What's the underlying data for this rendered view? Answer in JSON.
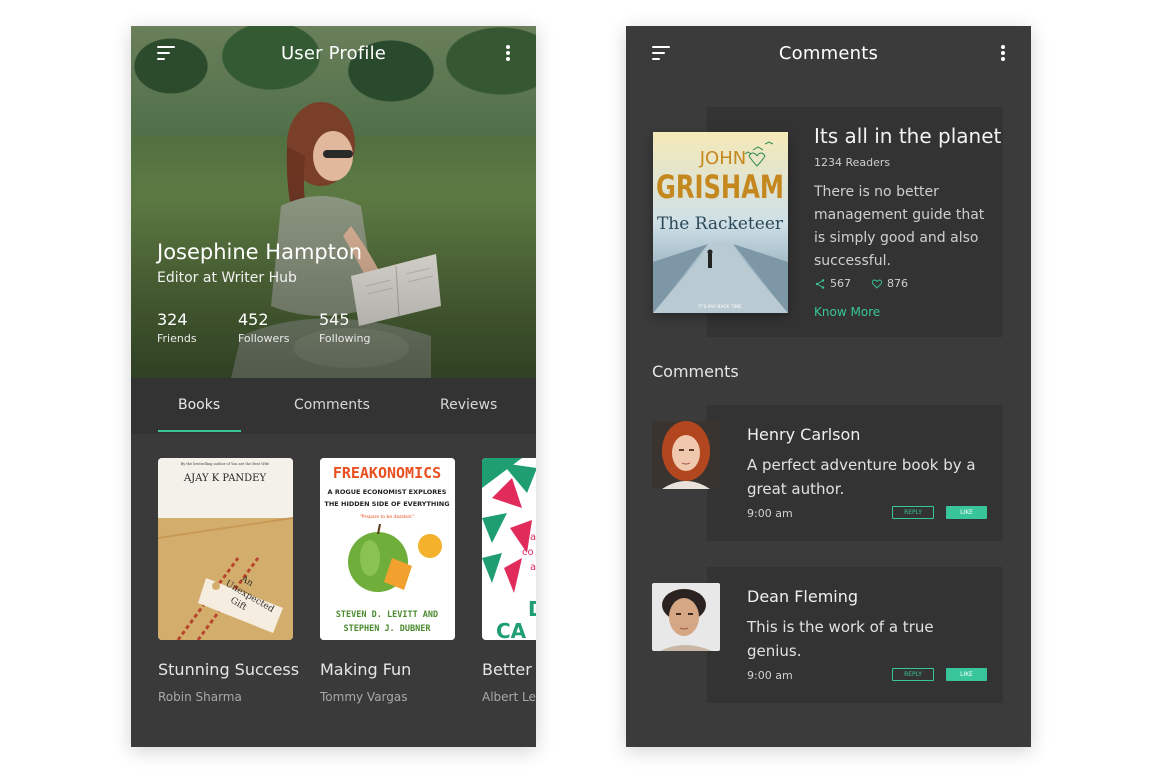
{
  "colors": {
    "accent": "#38c59a",
    "panel": "#3a3a3a",
    "card": "#333333"
  },
  "profile_screen": {
    "title": "User Profile",
    "menu_icon": "menu-icon",
    "more_icon": "more-vertical-icon",
    "name": "Josephine Hampton",
    "role": "Editor at Writer Hub",
    "stats": [
      {
        "value": "324",
        "label": "Friends"
      },
      {
        "value": "452",
        "label": "Followers"
      },
      {
        "value": "545",
        "label": "Following"
      }
    ],
    "tabs": [
      {
        "label": "Books",
        "active": true
      },
      {
        "label": "Comments",
        "active": false
      },
      {
        "label": "Reviews",
        "active": false
      }
    ],
    "books": [
      {
        "title": "Stunning Success",
        "author": "Robin Sharma",
        "cover": {
          "tagline": "By the bestselling author of You are the Best Wife",
          "cover_author": "AJAY K PANDEY",
          "cover_title_lines": [
            "An",
            "Unexpected",
            "Gift"
          ]
        }
      },
      {
        "title": "Making Fun",
        "author": "Tommy Vargas",
        "cover": {
          "cover_title": "FREAKONOMICS",
          "subtitle_lines": [
            "A ROGUE ECONOMIST EXPLORES",
            "THE HIDDEN SIDE OF EVERYTHING"
          ],
          "quote": "\"Prepare to be dazzled.\"",
          "authors_lines": [
            "STEVEN D. LEVITT AND",
            "STEPHEN J. DUBNER"
          ]
        }
      },
      {
        "title": "Better",
        "author": "Albert Lev",
        "cover": {
          "text_lines": [
            "a",
            "co",
            "a"
          ],
          "big_text_lines": [
            "D",
            "CA"
          ]
        }
      }
    ]
  },
  "comments_screen": {
    "title": "Comments",
    "menu_icon": "menu-icon",
    "more_icon": "more-vertical-icon",
    "featured": {
      "title": "Its all in the planet",
      "readers": "1234 Readers",
      "description": "There is no better management guide that is simply good and also successful.",
      "shares": "567",
      "likes": "876",
      "link": "Know More",
      "cover": {
        "author_first": "JOHN",
        "author_last": "GRISHAM",
        "cover_title": "The Racketeer",
        "tagline": "IT'S PAY BACK TIME"
      }
    },
    "section_title": "Comments",
    "comments": [
      {
        "name": "Henry Carlson",
        "text": "A perfect adventure book by a great author.",
        "time": "9:00 am",
        "reply": "REPLY",
        "like": "LIKE"
      },
      {
        "name": "Dean Fleming",
        "text": "This is the work of a true genius.",
        "time": "9:00 am",
        "reply": "REPLY",
        "like": "LIKE"
      }
    ]
  }
}
